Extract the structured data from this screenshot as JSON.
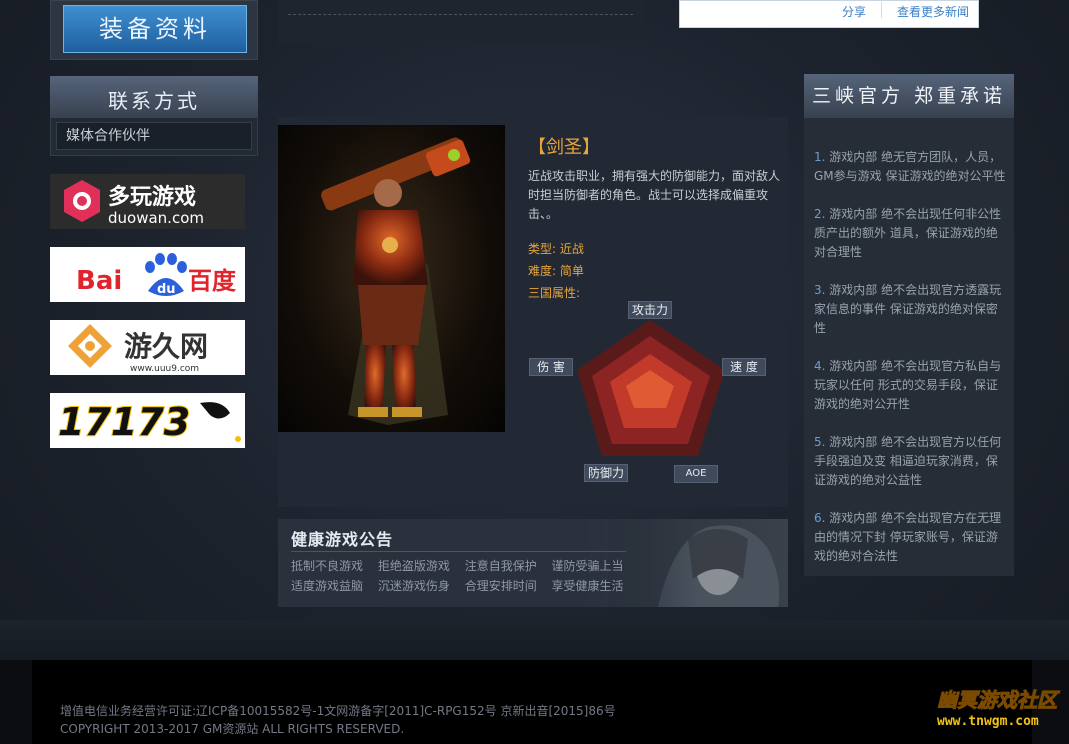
{
  "sidebar": {
    "equipment_button": "装备资料",
    "contact_title": "联系方式",
    "contact_item": "媒体合作伙伴",
    "partners": {
      "duowan_name": "多玩游戏",
      "duowan_url": "duowan.com",
      "baidu_latin": "Bai",
      "baidu_du": "du",
      "baidu_cn": "百度",
      "uuu9_name": "游久网",
      "uuu9_url": "www.uuu9.com",
      "gamesite_num": "17173"
    }
  },
  "news": {
    "share_label": "分享",
    "more_label": "查看更多新闻"
  },
  "hero": {
    "name": "【剑圣】",
    "description": "近战攻击职业，拥有强大的防御能力，面对敌人时担当防御者的角色。战士可以选择成偏重攻击、。",
    "type_label": "类型:",
    "type_value": "近战",
    "difficulty_label": "难度:",
    "difficulty_value": "简单",
    "attrs_label": "三国属性:",
    "radar": {
      "attack": "攻击力",
      "speed": "速 度",
      "aoe": "AOE",
      "defense": "防御力",
      "harm": "伤 害"
    }
  },
  "health": {
    "title": "健康游戏公告",
    "row1": [
      "抵制不良游戏",
      "拒绝盗版游戏",
      "注意自我保护",
      "谨防受骗上当"
    ],
    "row2": [
      "适度游戏益脑",
      "沉迷游戏伤身",
      "合理安排时间",
      "享受健康生活"
    ]
  },
  "promise": {
    "title": "三峡官方 郑重承诺",
    "items": [
      {
        "num": "1.",
        "text": "游戏内部 绝无官方团队，人员，GM参与游戏 保证游戏的绝对公平性"
      },
      {
        "num": "2.",
        "text": "游戏内部 绝不会出现任何非公性质产出的额外 道具，保证游戏的绝对合理性"
      },
      {
        "num": "3.",
        "text": "游戏内部 绝不会出现官方透露玩家信息的事件 保证游戏的绝对保密性"
      },
      {
        "num": "4.",
        "text": "游戏内部 绝不会出现官方私自与玩家以任何 形式的交易手段，保证游戏的绝对公开性"
      },
      {
        "num": "5.",
        "text": "游戏内部 绝不会出现官方以任何手段强迫及变 相逼迫玩家消费，保证游戏的绝对公益性"
      },
      {
        "num": "6.",
        "text": "游戏内部 绝不会出现官方在无理由的情况下封 停玩家账号，保证游戏的绝对合法性"
      }
    ]
  },
  "footer": {
    "line1": "增值电信业务经营许可证:辽ICP备10015582号-1文网游备字[2011]C-RPG152号 京新出音[2015]86号",
    "line2": "COPYRIGHT 2013-2017 GM资源站 ALL RIGHTS RESERVED.",
    "logo_cn": "幽冥游戏社区",
    "logo_url": "www.tnwgm.com"
  },
  "colors": {
    "accent_orange": "#e8a53a",
    "link_blue": "#3b7fc4",
    "panel": "#222934"
  }
}
